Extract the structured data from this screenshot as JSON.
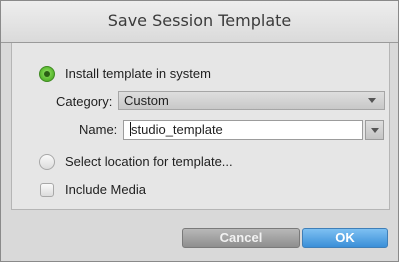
{
  "dialog": {
    "title": "Save Session Template"
  },
  "options": {
    "install_label": "Install template in system",
    "install_selected": true,
    "category_label": "Category:",
    "category_value": "Custom",
    "name_label": "Name:",
    "name_value": "studio_template",
    "select_location_label": "Select location for template...",
    "select_location_selected": false,
    "include_media_label": "Include Media",
    "include_media_checked": false
  },
  "buttons": {
    "cancel_label": "Cancel",
    "ok_label": "OK"
  },
  "colors": {
    "accent_green": "#62bf37",
    "ok_blue": "#3a8fd8"
  }
}
